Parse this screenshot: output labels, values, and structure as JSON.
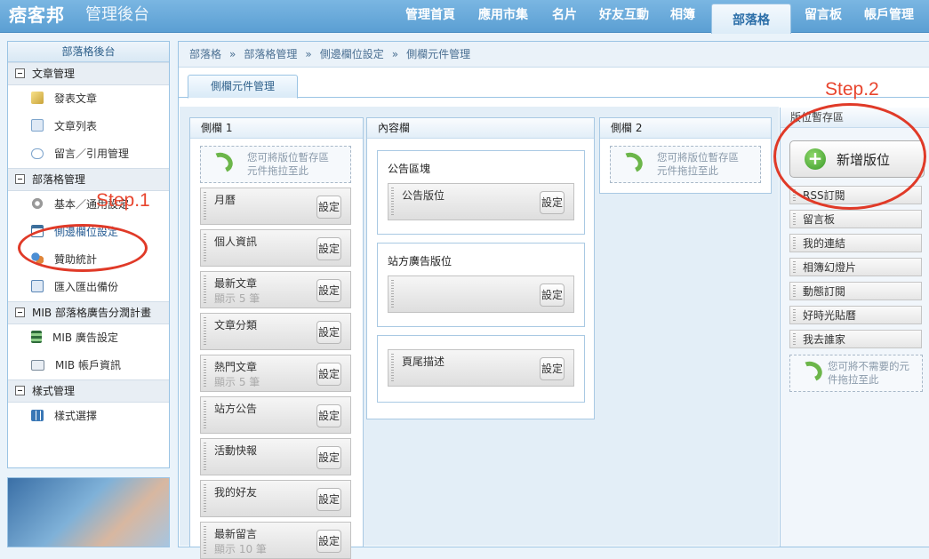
{
  "header": {
    "logo": "痞客邦",
    "admin_title": "管理後台",
    "nav": [
      {
        "label": "管理首頁"
      },
      {
        "label": "應用市集"
      },
      {
        "label": "名片"
      },
      {
        "label": "好友互動"
      },
      {
        "label": "相簿"
      },
      {
        "label": "部落格",
        "active": true
      },
      {
        "label": "留言板"
      },
      {
        "label": "帳戶管理"
      }
    ]
  },
  "sidebar": {
    "title": "部落格後台",
    "sections": [
      {
        "title": "文章管理",
        "items": [
          {
            "label": "發表文章",
            "icon": "pen-icon"
          },
          {
            "label": "文章列表",
            "icon": "documents-icon"
          },
          {
            "label": "留言／引用管理",
            "icon": "speech-bubble-icon"
          }
        ]
      },
      {
        "title": "部落格管理",
        "items": [
          {
            "label": "基本／通用設定",
            "icon": "gear-icon"
          },
          {
            "label": "側邊欄位設定",
            "icon": "window-icon"
          },
          {
            "label": "贊助統計",
            "icon": "people-icon"
          },
          {
            "label": "匯入匯出備份",
            "icon": "backup-icon"
          }
        ]
      },
      {
        "title": "MIB 部落格廣告分潤計畫",
        "items": [
          {
            "label": "MIB 廣告設定",
            "icon": "film-icon"
          },
          {
            "label": "MIB 帳戶資訊",
            "icon": "id-card-icon"
          }
        ]
      },
      {
        "title": "樣式管理",
        "items": [
          {
            "label": "樣式選擇",
            "icon": "grid-icon"
          }
        ]
      }
    ]
  },
  "breadcrumb": [
    "部落格",
    "部落格管理",
    "側邊欄位設定",
    "側欄元件管理"
  ],
  "breadcrumb_sep": "»",
  "tab": {
    "label": "側欄元件管理"
  },
  "sidebar1": {
    "title": "側欄 1",
    "drop_hint": [
      "您可將版位暫存區",
      "元件拖拉至此"
    ],
    "widgets": [
      {
        "name": "月曆",
        "sub": ""
      },
      {
        "name": "個人資訊",
        "sub": ""
      },
      {
        "name": "最新文章",
        "sub": "顯示 5 筆"
      },
      {
        "name": "文章分類",
        "sub": ""
      },
      {
        "name": "熱門文章",
        "sub": "顯示 5 筆"
      },
      {
        "name": "站方公告",
        "sub": ""
      },
      {
        "name": "活動快報",
        "sub": ""
      },
      {
        "name": "我的好友",
        "sub": ""
      },
      {
        "name": "最新留言",
        "sub": "顯示 10 筆"
      }
    ]
  },
  "setting_label": "設定",
  "content_col": {
    "title": "內容欄",
    "boxes": [
      {
        "title": "公告區塊",
        "widget": "公告版位"
      },
      {
        "title": "站方廣告版位",
        "widget": ""
      },
      {
        "title": "",
        "widget": "頁尾描述"
      }
    ]
  },
  "sidebar2": {
    "title": "側欄 2",
    "drop_hint": [
      "您可將版位暫存區",
      "元件拖拉至此"
    ]
  },
  "storage": {
    "title": "版位暫存區",
    "add_button": "新增版位",
    "items": [
      "RSS訂閱",
      "留言板",
      "我的連結",
      "相簿幻燈片",
      "動態訂閱",
      "好時光貼曆",
      "我去誰家"
    ],
    "drop_hint": [
      "您可將不需要的元",
      "件拖拉至此"
    ]
  },
  "annotations": {
    "step1": "Step.1",
    "step2": "Step.2",
    "color": "#e03a28"
  }
}
